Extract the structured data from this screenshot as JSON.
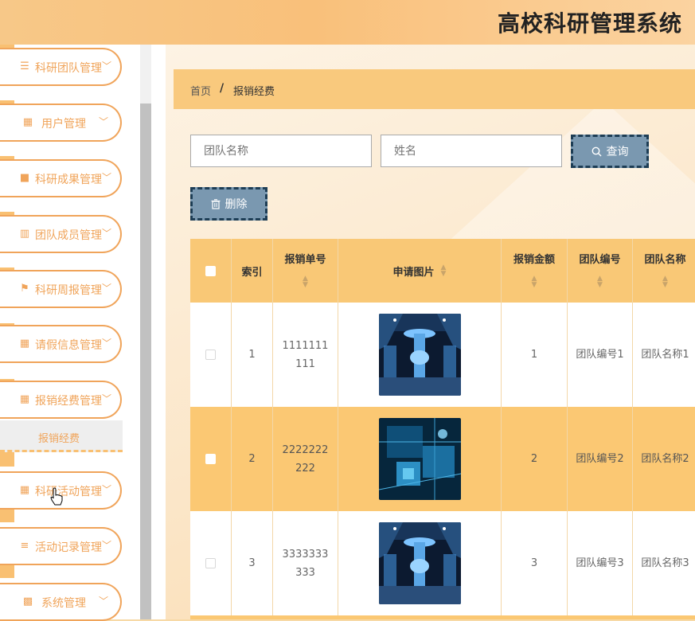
{
  "header": {
    "title": "高校科研管理系统"
  },
  "sidebar": {
    "items": [
      {
        "label": "科研团队管理",
        "icon": "sliders-icon"
      },
      {
        "label": "用户管理",
        "icon": "grid-icon"
      },
      {
        "label": "科研成果管理",
        "icon": "briefcase-icon"
      },
      {
        "label": "团队成员管理",
        "icon": "books-icon"
      },
      {
        "label": "科研周报管理",
        "icon": "flag-icon"
      },
      {
        "label": "请假信息管理",
        "icon": "grid-icon"
      },
      {
        "label": "报销经费管理",
        "icon": "grid-icon"
      },
      {
        "label": "科研活动管理",
        "icon": "grid-icon"
      },
      {
        "label": "活动记录管理",
        "icon": "list-icon"
      },
      {
        "label": "系统管理",
        "icon": "apps-icon"
      }
    ],
    "submenu": {
      "label": "报销经费"
    }
  },
  "breadcrumb": {
    "home": "首页",
    "separator": "/",
    "current": "报销经费"
  },
  "search": {
    "team_placeholder": "团队名称",
    "name_placeholder": "姓名",
    "button_label": "查询"
  },
  "toolbar": {
    "delete_label": "删除"
  },
  "table": {
    "columns": [
      "索引",
      "报销单号",
      "申请图片",
      "报销金额",
      "团队编号",
      "团队名称"
    ],
    "rows": [
      {
        "index": "1",
        "number": "1111111111",
        "amount": "1",
        "team_no": "团队编号1",
        "team_name": "团队名称1"
      },
      {
        "index": "2",
        "number": "2222222222",
        "amount": "2",
        "team_no": "团队编号2",
        "team_name": "团队名称2"
      },
      {
        "index": "3",
        "number": "3333333333",
        "amount": "3",
        "team_no": "团队编号3",
        "team_name": "团队名称3"
      }
    ]
  },
  "colors": {
    "accent": "#f9c876",
    "menu_text": "#f0a45a",
    "button": "#7a98b0"
  }
}
